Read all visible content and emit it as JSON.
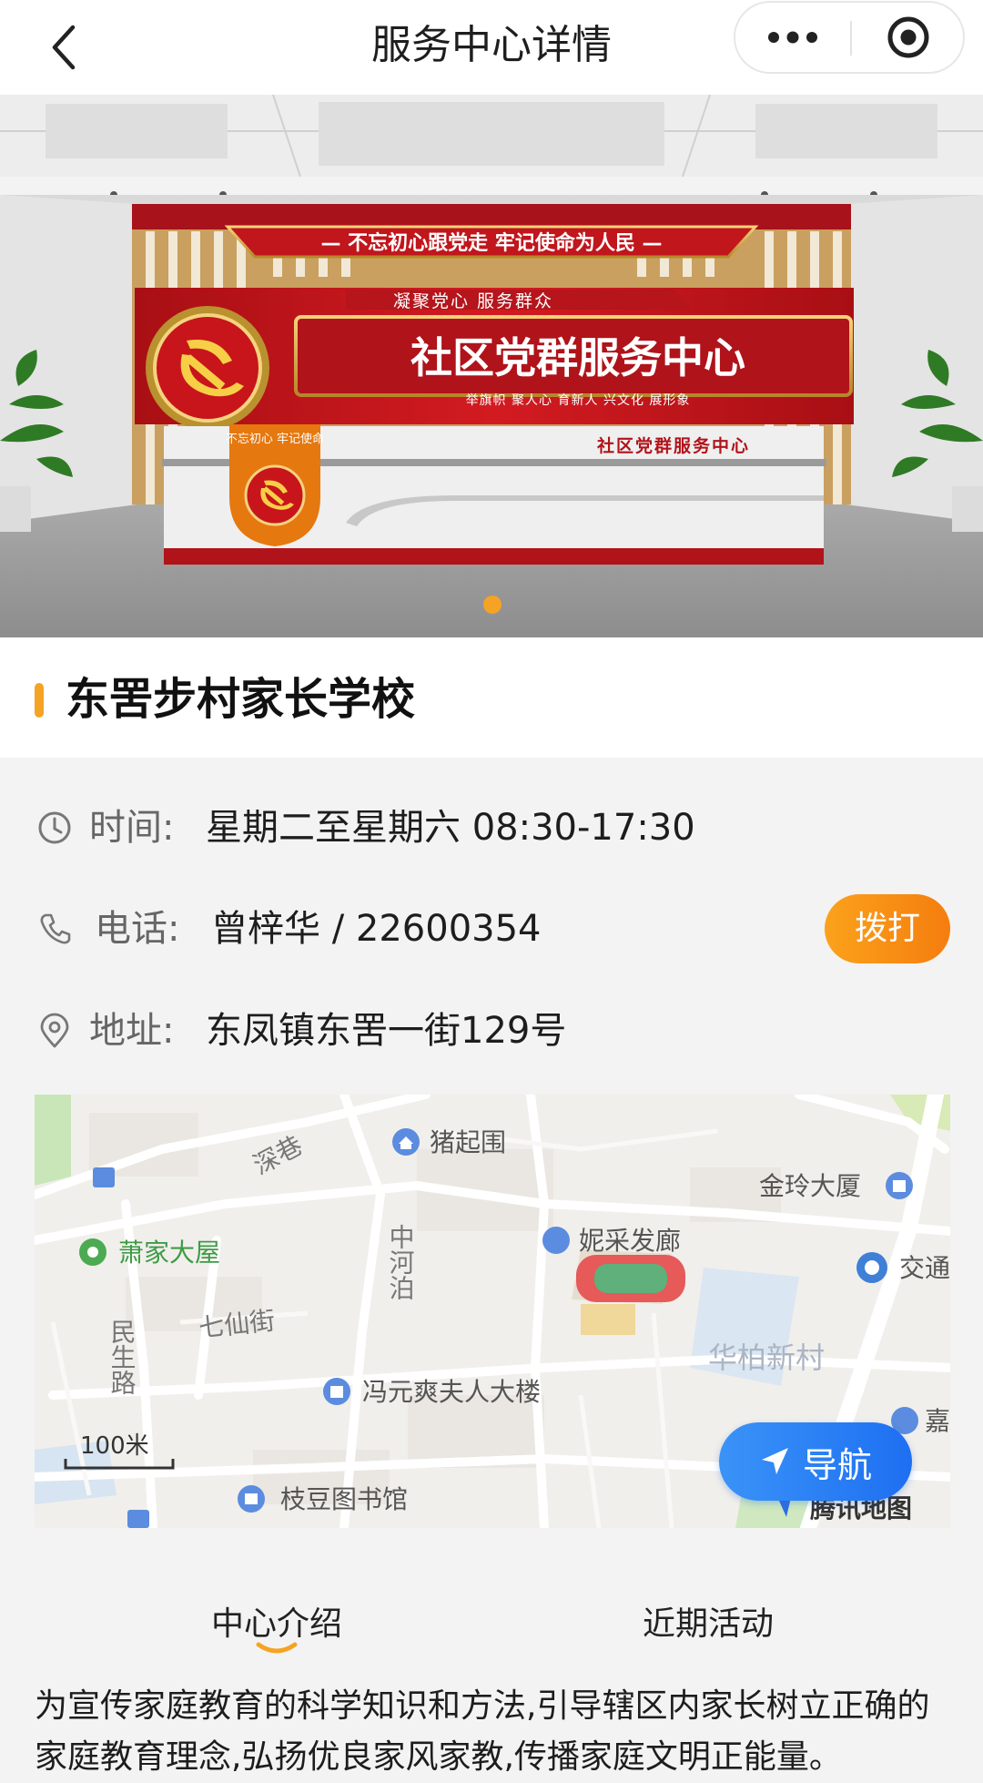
{
  "nav": {
    "title": "服务中心详情"
  },
  "banner": {
    "slogan_top": "— 不忘初心跟党走  牢记使命为人民 —",
    "subtitle": "凝聚党心 服务群众",
    "main_sign": "社区党群服务中心",
    "sub_slogan": "举旗帜 聚人心 育新人 兴文化 展形象",
    "desk_sign": "社区党群服务中心",
    "desk_badge": "不忘初心 牢记使命",
    "slide_count": 1,
    "active_slide": 1
  },
  "center": {
    "name": "东罟步村家长学校"
  },
  "info": {
    "time_label": "时间:",
    "time_value": "星期二至星期六  08:30-17:30",
    "phone_label": "电话:",
    "phone_value": "曾梓华 / 22600354",
    "call_button": "拨打",
    "address_label": "地址:",
    "address_value": "东凤镇东罟一街129号"
  },
  "map": {
    "pois": {
      "zhuqiwei": "猪起围",
      "shenxiang": "深巷",
      "jinling": "金玲大厦",
      "xiaojia": "萧家大屋",
      "zhonghebo": "中河泊",
      "nicai": "妮采发廊",
      "jiaotong": "交通",
      "minsheng": "民生路",
      "qixian": "七仙街",
      "huabai": "华柏新村",
      "fengyuan": "冯元爽夫人大楼",
      "jia": "嘉",
      "zhidou": "枝豆图书馆"
    },
    "scale": "100米",
    "logo": "腾讯地图",
    "nav_button": "导航"
  },
  "tabs": {
    "intro": "中心介绍",
    "activities": "近期活动",
    "active": "intro"
  },
  "description": "为宣传家庭教育的科学知识和方法,引导辖区内家长树立正确的家庭教育理念,弘扬优良家风家教,传播家庭文明正能量。",
  "colors": {
    "accent": "#f5a324",
    "call_button": "#f78d16",
    "nav_button": "#2a82f4",
    "party_red": "#c0161c"
  }
}
